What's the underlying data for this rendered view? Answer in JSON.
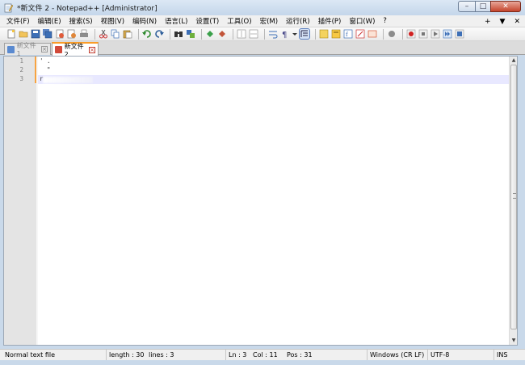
{
  "window": {
    "title": "*新文件 2 - Notepad++ [Administrator]",
    "controls": {
      "minimize": "–",
      "maximize": "□",
      "close": "✕"
    }
  },
  "menu": {
    "items": [
      "文件(F)",
      "编辑(E)",
      "搜索(S)",
      "视图(V)",
      "编码(N)",
      "语言(L)",
      "设置(T)",
      "工具(O)",
      "宏(M)",
      "运行(R)",
      "插件(P)",
      "窗口(W)",
      "?"
    ],
    "right": {
      "pin": "+",
      "dropdown": "▼",
      "close": "✕"
    }
  },
  "toolbar": {
    "icons": [
      "new-file-icon",
      "open-file-icon",
      "save-icon",
      "save-all-icon",
      "close-icon",
      "close-all-icon",
      "print-icon",
      "cut-icon",
      "copy-icon",
      "paste-icon",
      "undo-icon",
      "redo-icon",
      "find-icon",
      "replace-icon",
      "zoom-in-icon",
      "zoom-out-icon",
      "sync-vertical-icon",
      "sync-horizontal-icon",
      "word-wrap-icon",
      "show-all-chars-icon",
      "indent-guide-icon",
      "user-language-icon",
      "doc-map-icon",
      "function-list-icon",
      "folder-workspace-icon",
      "monitoring-icon",
      "record-macro-icon",
      "stop-macro-icon",
      "play-macro-icon",
      "run-macro-multiple-icon",
      "save-macro-icon"
    ]
  },
  "tabs": [
    {
      "label": "新文件 1",
      "active": false
    },
    {
      "label": "新文件 2",
      "active": true
    }
  ],
  "editor": {
    "line_numbers": [
      "1",
      "2",
      "3"
    ],
    "lines": [
      "' .",
      "  \"",
      "r"
    ]
  },
  "statusbar": {
    "file_type": "Normal text file",
    "length": "length : 30",
    "lines": "lines : 3",
    "ln": "Ln : 3",
    "col": "Col : 11",
    "pos": "Pos : 31",
    "eol": "Windows (CR LF)",
    "encoding": "UTF-8",
    "mode": "INS"
  }
}
